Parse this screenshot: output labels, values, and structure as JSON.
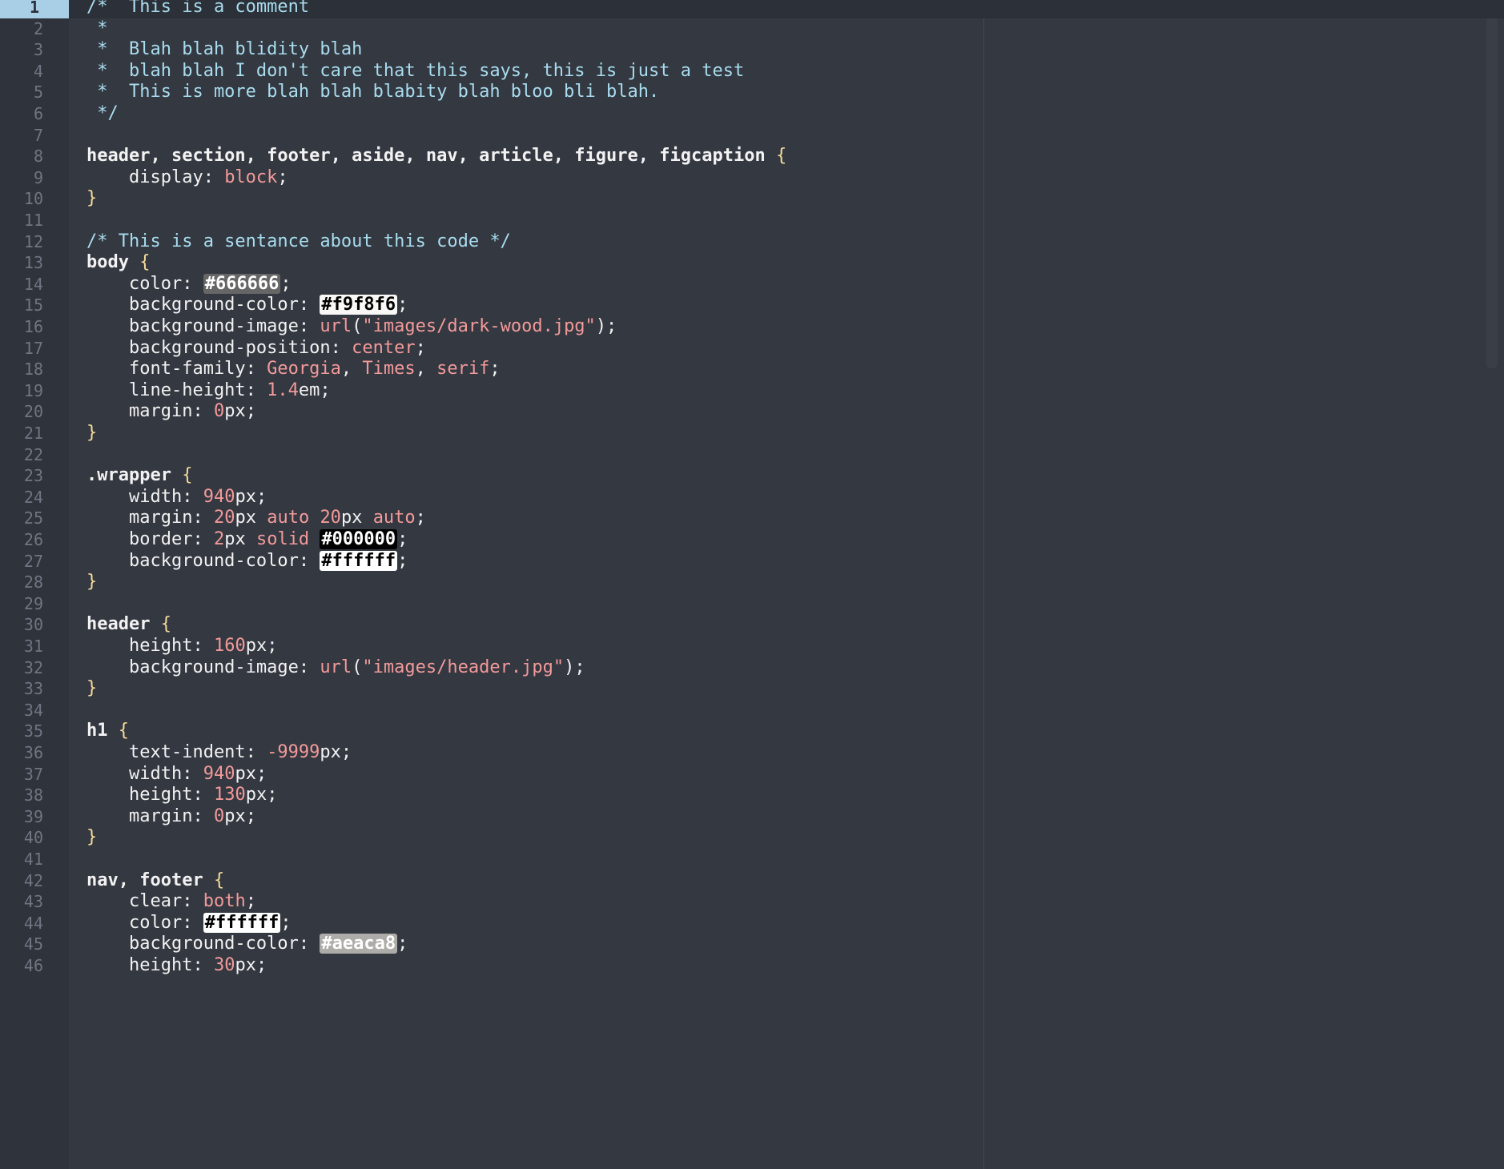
{
  "editor": {
    "language": "css",
    "current_line": 1,
    "colors": {
      "background": "#343841",
      "comment": "#a8dcee",
      "value": "#f29a9a",
      "brace": "#f4d99a",
      "text": "#f2f2f2",
      "line_number": "#6f7582",
      "current_line_highlight": "#a9cfe6"
    },
    "lines": [
      {
        "n": "1",
        "tokens": [
          {
            "t": "/*  This is a comment",
            "c": "comment"
          }
        ]
      },
      {
        "n": "2",
        "tokens": [
          {
            "t": " *",
            "c": "comment"
          }
        ]
      },
      {
        "n": "3",
        "tokens": [
          {
            "t": " *  Blah blah blidity blah",
            "c": "comment"
          }
        ]
      },
      {
        "n": "4",
        "tokens": [
          {
            "t": " *  blah blah I don't care that this says, this is just a test",
            "c": "comment"
          }
        ]
      },
      {
        "n": "5",
        "tokens": [
          {
            "t": " *  This is more blah blah blabity blah bloo bli blah.",
            "c": "comment"
          }
        ]
      },
      {
        "n": "6",
        "tokens": [
          {
            "t": " */",
            "c": "comment"
          }
        ]
      },
      {
        "n": "7",
        "tokens": []
      },
      {
        "n": "8",
        "tokens": [
          {
            "t": "header, section, footer, aside, nav, article, figure, figcaption ",
            "c": "sel"
          },
          {
            "t": "{",
            "c": "brace"
          }
        ]
      },
      {
        "n": "9",
        "tokens": [
          {
            "t": "    display: ",
            "c": "prop"
          },
          {
            "t": "block",
            "c": "val"
          },
          {
            "t": ";",
            "c": "punct"
          }
        ]
      },
      {
        "n": "10",
        "tokens": [
          {
            "t": "}",
            "c": "brace"
          }
        ]
      },
      {
        "n": "11",
        "tokens": []
      },
      {
        "n": "12",
        "tokens": [
          {
            "t": "/* This is a sentance about this code */",
            "c": "comment"
          }
        ]
      },
      {
        "n": "13",
        "tokens": [
          {
            "t": "body ",
            "c": "sel"
          },
          {
            "t": "{",
            "c": "brace"
          }
        ]
      },
      {
        "n": "14",
        "tokens": [
          {
            "t": "    color: ",
            "c": "prop"
          },
          {
            "t": "#666666",
            "c": "swatch",
            "bg": "#666666",
            "fg": "#ffffff"
          },
          {
            "t": ";",
            "c": "punct"
          }
        ]
      },
      {
        "n": "15",
        "tokens": [
          {
            "t": "    background-color: ",
            "c": "prop"
          },
          {
            "t": "#f9f8f6",
            "c": "swatch",
            "bg": "#f9f8f6",
            "fg": "#000000"
          },
          {
            "t": ";",
            "c": "punct"
          }
        ]
      },
      {
        "n": "16",
        "tokens": [
          {
            "t": "    background-image: ",
            "c": "prop"
          },
          {
            "t": "url",
            "c": "fn"
          },
          {
            "t": "(",
            "c": "punct"
          },
          {
            "t": "\"images/dark-wood.jpg\"",
            "c": "str"
          },
          {
            "t": ");",
            "c": "punct"
          }
        ]
      },
      {
        "n": "17",
        "tokens": [
          {
            "t": "    background-position: ",
            "c": "prop"
          },
          {
            "t": "center",
            "c": "val"
          },
          {
            "t": ";",
            "c": "punct"
          }
        ]
      },
      {
        "n": "18",
        "tokens": [
          {
            "t": "    font-family: ",
            "c": "prop"
          },
          {
            "t": "Georgia",
            "c": "val"
          },
          {
            "t": ", ",
            "c": "punct"
          },
          {
            "t": "Times",
            "c": "val"
          },
          {
            "t": ", ",
            "c": "punct"
          },
          {
            "t": "serif",
            "c": "val"
          },
          {
            "t": ";",
            "c": "punct"
          }
        ]
      },
      {
        "n": "19",
        "tokens": [
          {
            "t": "    line-height: ",
            "c": "prop"
          },
          {
            "t": "1.4",
            "c": "val"
          },
          {
            "t": "em;",
            "c": "punct"
          }
        ]
      },
      {
        "n": "20",
        "tokens": [
          {
            "t": "    margin: ",
            "c": "prop"
          },
          {
            "t": "0",
            "c": "val"
          },
          {
            "t": "px;",
            "c": "punct"
          }
        ]
      },
      {
        "n": "21",
        "tokens": [
          {
            "t": "}",
            "c": "brace"
          }
        ]
      },
      {
        "n": "22",
        "tokens": []
      },
      {
        "n": "23",
        "tokens": [
          {
            "t": ".wrapper ",
            "c": "sel"
          },
          {
            "t": "{",
            "c": "brace"
          }
        ]
      },
      {
        "n": "24",
        "tokens": [
          {
            "t": "    width: ",
            "c": "prop"
          },
          {
            "t": "940",
            "c": "val"
          },
          {
            "t": "px;",
            "c": "punct"
          }
        ]
      },
      {
        "n": "25",
        "tokens": [
          {
            "t": "    margin: ",
            "c": "prop"
          },
          {
            "t": "20",
            "c": "val"
          },
          {
            "t": "px ",
            "c": "punct"
          },
          {
            "t": "auto ",
            "c": "val"
          },
          {
            "t": "20",
            "c": "val"
          },
          {
            "t": "px ",
            "c": "punct"
          },
          {
            "t": "auto",
            "c": "val"
          },
          {
            "t": ";",
            "c": "punct"
          }
        ]
      },
      {
        "n": "26",
        "tokens": [
          {
            "t": "    border: ",
            "c": "prop"
          },
          {
            "t": "2",
            "c": "val"
          },
          {
            "t": "px ",
            "c": "punct"
          },
          {
            "t": "solid ",
            "c": "val"
          },
          {
            "t": "#000000",
            "c": "swatch",
            "bg": "#000000",
            "fg": "#ffffff"
          },
          {
            "t": ";",
            "c": "punct"
          }
        ]
      },
      {
        "n": "27",
        "tokens": [
          {
            "t": "    background-color: ",
            "c": "prop"
          },
          {
            "t": "#ffffff",
            "c": "swatch",
            "bg": "#ffffff",
            "fg": "#000000"
          },
          {
            "t": ";",
            "c": "punct"
          }
        ]
      },
      {
        "n": "28",
        "tokens": [
          {
            "t": "}",
            "c": "brace"
          }
        ]
      },
      {
        "n": "29",
        "tokens": []
      },
      {
        "n": "30",
        "tokens": [
          {
            "t": "header ",
            "c": "sel"
          },
          {
            "t": "{",
            "c": "brace"
          }
        ]
      },
      {
        "n": "31",
        "tokens": [
          {
            "t": "    height: ",
            "c": "prop"
          },
          {
            "t": "160",
            "c": "val"
          },
          {
            "t": "px;",
            "c": "punct"
          }
        ]
      },
      {
        "n": "32",
        "tokens": [
          {
            "t": "    background-image: ",
            "c": "prop"
          },
          {
            "t": "url",
            "c": "fn"
          },
          {
            "t": "(",
            "c": "punct"
          },
          {
            "t": "\"images/header.jpg\"",
            "c": "str"
          },
          {
            "t": ");",
            "c": "punct"
          }
        ]
      },
      {
        "n": "33",
        "tokens": [
          {
            "t": "}",
            "c": "brace"
          }
        ]
      },
      {
        "n": "34",
        "tokens": []
      },
      {
        "n": "35",
        "tokens": [
          {
            "t": "h1 ",
            "c": "sel"
          },
          {
            "t": "{",
            "c": "brace"
          }
        ]
      },
      {
        "n": "36",
        "tokens": [
          {
            "t": "    text-indent: ",
            "c": "prop"
          },
          {
            "t": "-9999",
            "c": "val"
          },
          {
            "t": "px;",
            "c": "punct"
          }
        ]
      },
      {
        "n": "37",
        "tokens": [
          {
            "t": "    width: ",
            "c": "prop"
          },
          {
            "t": "940",
            "c": "val"
          },
          {
            "t": "px;",
            "c": "punct"
          }
        ]
      },
      {
        "n": "38",
        "tokens": [
          {
            "t": "    height: ",
            "c": "prop"
          },
          {
            "t": "130",
            "c": "val"
          },
          {
            "t": "px;",
            "c": "punct"
          }
        ]
      },
      {
        "n": "39",
        "tokens": [
          {
            "t": "    margin: ",
            "c": "prop"
          },
          {
            "t": "0",
            "c": "val"
          },
          {
            "t": "px;",
            "c": "punct"
          }
        ]
      },
      {
        "n": "40",
        "tokens": [
          {
            "t": "}",
            "c": "brace"
          }
        ]
      },
      {
        "n": "41",
        "tokens": []
      },
      {
        "n": "42",
        "tokens": [
          {
            "t": "nav, footer ",
            "c": "sel"
          },
          {
            "t": "{",
            "c": "brace"
          }
        ]
      },
      {
        "n": "43",
        "tokens": [
          {
            "t": "    clear: ",
            "c": "prop"
          },
          {
            "t": "both",
            "c": "val"
          },
          {
            "t": ";",
            "c": "punct"
          }
        ]
      },
      {
        "n": "44",
        "tokens": [
          {
            "t": "    color: ",
            "c": "prop"
          },
          {
            "t": "#ffffff",
            "c": "swatch",
            "bg": "#ffffff",
            "fg": "#000000"
          },
          {
            "t": ";",
            "c": "punct"
          }
        ]
      },
      {
        "n": "45",
        "tokens": [
          {
            "t": "    background-color: ",
            "c": "prop"
          },
          {
            "t": "#aeaca8",
            "c": "swatch",
            "bg": "#aeaca8",
            "fg": "#ffffff"
          },
          {
            "t": ";",
            "c": "punct"
          }
        ]
      },
      {
        "n": "46",
        "tokens": [
          {
            "t": "    height: ",
            "c": "prop"
          },
          {
            "t": "30",
            "c": "val"
          },
          {
            "t": "px;",
            "c": "punct"
          }
        ]
      }
    ]
  }
}
